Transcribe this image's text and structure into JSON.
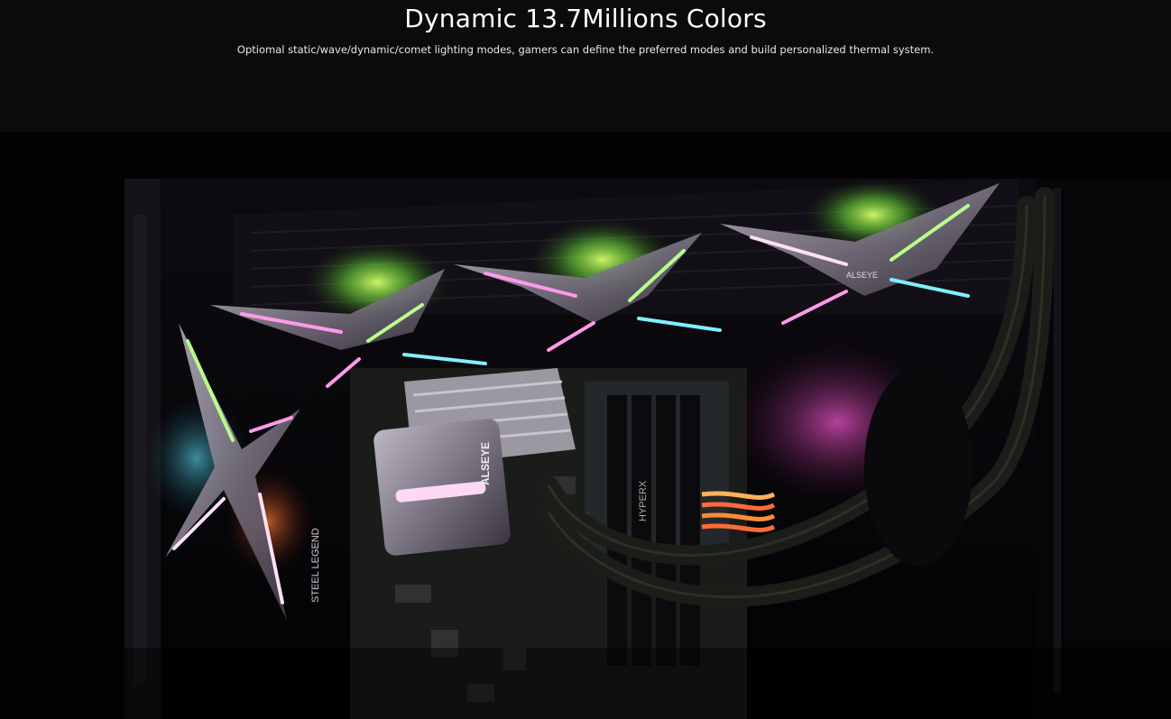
{
  "section": {
    "title": "Dynamic 13.7Millions Colors",
    "subtitle": "Optiomal static/wave/dynamic/comet lighting modes, gamers can define the preferred modes and build personalized thermal system."
  },
  "image": {
    "subject": "RGB liquid cooler inside PC case with fans and motherboard",
    "labels": {
      "fan_brand": "ALSEYE",
      "ram_brand": "HYPERX",
      "board_label": "STEEL LEGEND",
      "pump_brand": "ALSEYE"
    }
  },
  "colors": {
    "header_bg": "#0b0b0b",
    "photo_bg": "#040103",
    "title_color": "#ffffff",
    "rgb_green": "#9cff4a",
    "rgb_magenta": "#ff4fd8",
    "rgb_cyan": "#5fe6ff"
  }
}
